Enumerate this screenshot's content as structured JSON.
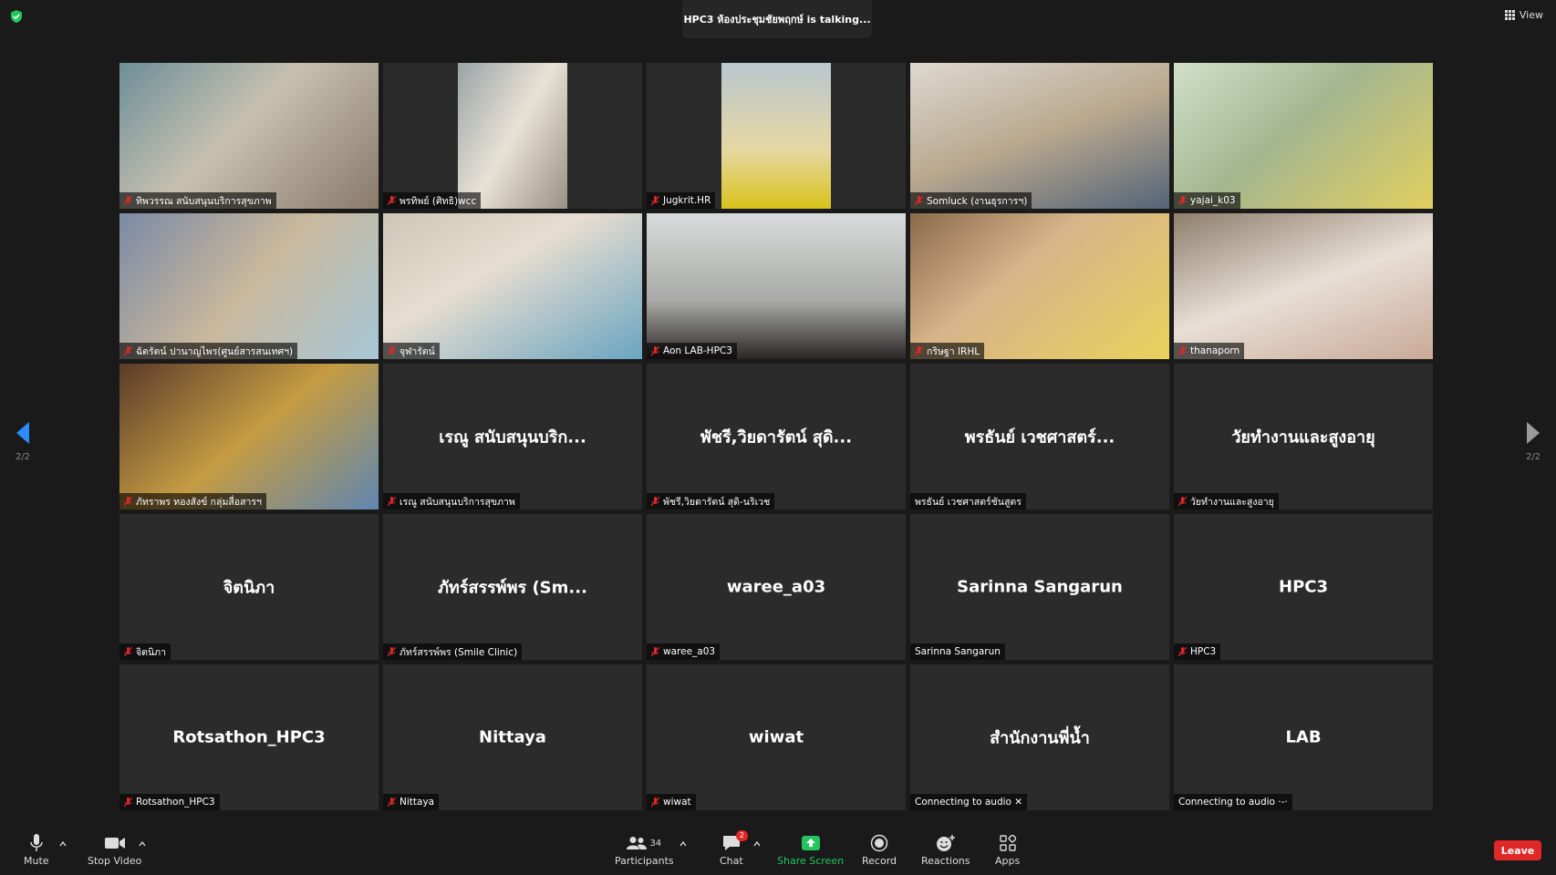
{
  "header": {
    "talking_banner": "HPC3 ห้องประชุมชัยพฤกษ์ is talking...",
    "view_label": "View"
  },
  "pager": {
    "left_text": "2/2",
    "right_text": "2/2"
  },
  "tiles": [
    {
      "big": "",
      "label": "ทิพวรรณ สนับสนุนบริการสุขภาพ",
      "muted": true
    },
    {
      "big": "",
      "label": "พรทิพย์ (ศิทธิ)wcc",
      "muted": true
    },
    {
      "big": "",
      "label": "Jugkrit.HR",
      "muted": true
    },
    {
      "big": "",
      "label": "Somluck (งานธุรการฯ)",
      "muted": true
    },
    {
      "big": "",
      "label": "yajai_k03",
      "muted": true
    },
    {
      "big": "",
      "label": "ฉัตรัตน์ ปานาญไพร(ศูนย์สารสนเทศฯ)",
      "muted": true
    },
    {
      "big": "",
      "label": "จุฬารัตน์",
      "muted": true
    },
    {
      "big": "",
      "label": "Aon LAB-HPC3",
      "muted": true
    },
    {
      "big": "",
      "label": "กริษฐา IRHL",
      "muted": true
    },
    {
      "big": "",
      "label": "thanaporn",
      "muted": true
    },
    {
      "big": "",
      "label": "ภัทราพร ทองสังข์ กลุ่มสื่อสารฯ",
      "muted": true
    },
    {
      "big": "เรณู สนับสนุนบริก...",
      "label": "เรณู สนับสนุนบริการสุขภาพ",
      "muted": true
    },
    {
      "big": "พัชรี,วิยดารัตน์ สุดิ...",
      "label": "พัชรี,วิยดารัตน์ สุดิ-นริเวช",
      "muted": true
    },
    {
      "big": "พรธันย์ เวชศาสตร์...",
      "label": "พรธันย์ เวชศาสตร์ชันสูตร",
      "muted": false
    },
    {
      "big": "วัยทำงานและสูงอายุ",
      "label": "วัยทำงานและสูงอายุ",
      "muted": true
    },
    {
      "big": "จิตนิภา",
      "label": "จิตนิภา",
      "muted": true
    },
    {
      "big": "ภัทร์สรรพ์พร (Sm...",
      "label": "ภัทร์สรรพ์พร (Smile Clinic)",
      "muted": true
    },
    {
      "big": "waree_a03",
      "label": "waree_a03",
      "muted": true
    },
    {
      "big": "Sarinna Sangarun",
      "label": "Sarinna Sangarun",
      "muted": false
    },
    {
      "big": "HPC3",
      "label": "HPC3",
      "muted": true
    },
    {
      "big": "Rotsathon_HPC3",
      "label": "Rotsathon_HPC3",
      "muted": true
    },
    {
      "big": "Nittaya",
      "label": "Nittaya",
      "muted": true
    },
    {
      "big": "wiwat",
      "label": "wiwat",
      "muted": true
    },
    {
      "big": "สำนักงานพี่น้ำ",
      "label": "Connecting to audio ✕",
      "muted": false
    },
    {
      "big": "LAB",
      "label": "Connecting to audio ·-·",
      "muted": false
    }
  ],
  "toolbar": {
    "mute": "Mute",
    "stop_video": "Stop Video",
    "participants": "Participants",
    "participants_count": "34",
    "chat": "Chat",
    "chat_badge": "2",
    "share_screen": "Share Screen",
    "record": "Record",
    "reactions": "Reactions",
    "apps": "Apps",
    "leave": "Leave"
  },
  "colors": {
    "share_green": "#22c55e",
    "leave_red": "#e02828",
    "pager_blue": "#2d8cff"
  }
}
